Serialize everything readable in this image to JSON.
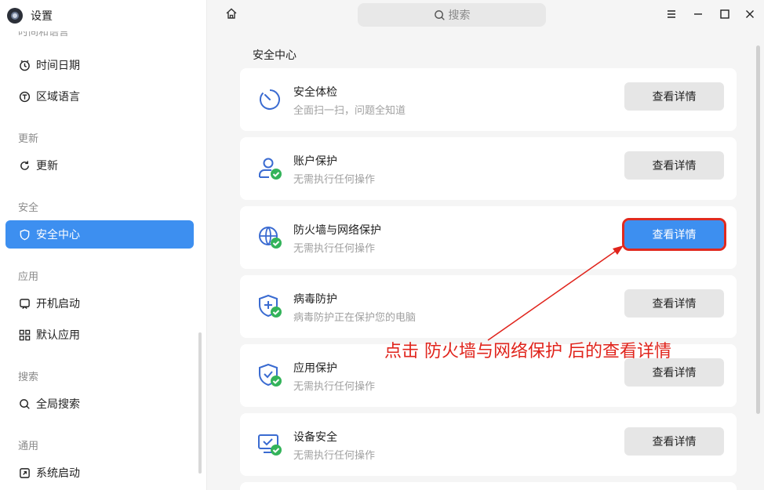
{
  "app": {
    "title": "设置",
    "cut_section": "时间和语言"
  },
  "sidebar": {
    "items": [
      {
        "label": "时间日期",
        "icon": "clock-icon"
      },
      {
        "label": "区域语言",
        "icon": "region-language-icon"
      },
      {
        "label": "更新",
        "icon": "refresh-icon"
      },
      {
        "label": "安全中心",
        "icon": "shield-icon",
        "active": true
      },
      {
        "label": "开机启动",
        "icon": "startup-icon"
      },
      {
        "label": "默认应用",
        "icon": "apps-grid-icon"
      },
      {
        "label": "全局搜索",
        "icon": "search-icon"
      },
      {
        "label": "系统启动",
        "icon": "boot-icon"
      }
    ],
    "sections": [
      "更新",
      "安全",
      "应用",
      "搜索",
      "通用"
    ]
  },
  "topbar": {
    "search_placeholder": "搜索"
  },
  "main": {
    "title": "安全中心",
    "cards": [
      {
        "title": "安全体检",
        "subtitle": "全面扫一扫，问题全知道",
        "button": "查看详情",
        "icon": "scan-icon"
      },
      {
        "title": "账户保护",
        "subtitle": "无需执行任何操作",
        "button": "查看详情",
        "icon": "account-protect-icon"
      },
      {
        "title": "防火墙与网络保护",
        "subtitle": "无需执行任何操作",
        "button": "查看详情",
        "icon": "firewall-globe-icon"
      },
      {
        "title": "病毒防护",
        "subtitle": "病毒防护正在保护您的电脑",
        "button": "查看详情",
        "icon": "virus-shield-icon"
      },
      {
        "title": "应用保护",
        "subtitle": "无需执行任何操作",
        "button": "查看详情",
        "icon": "app-protect-icon"
      },
      {
        "title": "设备安全",
        "subtitle": "无需执行任何操作",
        "button": "查看详情",
        "icon": "device-security-icon"
      }
    ]
  },
  "annotation": {
    "text": "点击 防火墙与网络保护 后的查看详情",
    "color": "#e0241c"
  },
  "colors": {
    "accent": "#3d8ff0",
    "ok_green": "#33b35a",
    "icon_blue": "#3a6bd1",
    "highlight_red": "#e02a1f"
  }
}
